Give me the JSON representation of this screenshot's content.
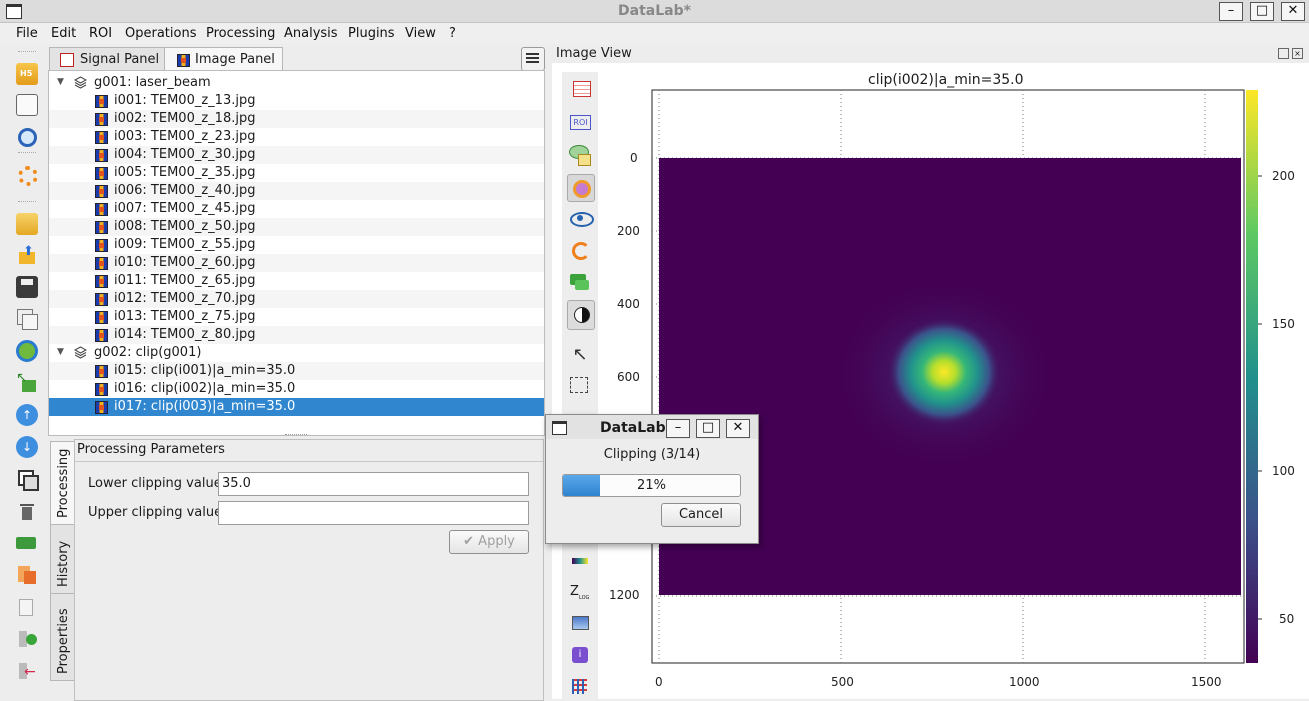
{
  "window": {
    "title": "DataLab*"
  },
  "menu": [
    "File",
    "Edit",
    "ROI",
    "Operations",
    "Processing",
    "Analysis",
    "Plugins",
    "View",
    "?"
  ],
  "toolbar_icons": [
    "open-h5-icon",
    "save-h5-icon",
    "browse-h5-icon",
    "settings-icon",
    "open-folder-icon",
    "import-icon",
    "save-icon",
    "duplicate-icon",
    "refresh-icon",
    "export-icon",
    "move-up-icon",
    "move-down-icon",
    "copy-icon",
    "delete-icon",
    "add-group-icon",
    "paste-metadata-icon",
    "copy-metadata-icon",
    "add-result-icon",
    "remove-result-icon"
  ],
  "tabs": {
    "signal": "Signal Panel",
    "image": "Image Panel"
  },
  "tree": {
    "groups": [
      {
        "label": "g001: laser_beam",
        "items": [
          "i001: TEM00_z_13.jpg",
          "i002: TEM00_z_18.jpg",
          "i003: TEM00_z_23.jpg",
          "i004: TEM00_z_30.jpg",
          "i005: TEM00_z_35.jpg",
          "i006: TEM00_z_40.jpg",
          "i007: TEM00_z_45.jpg",
          "i008: TEM00_z_50.jpg",
          "i009: TEM00_z_55.jpg",
          "i010: TEM00_z_60.jpg",
          "i011: TEM00_z_65.jpg",
          "i012: TEM00_z_70.jpg",
          "i013: TEM00_z_75.jpg",
          "i014: TEM00_z_80.jpg"
        ]
      },
      {
        "label": "g002: clip(g001)",
        "items": [
          "i015: clip(i001)|a_min=35.0",
          "i016: clip(i002)|a_min=35.0",
          "i017: clip(i003)|a_min=35.0"
        ]
      }
    ],
    "selected": "i017: clip(i003)|a_min=35.0"
  },
  "side_tabs": [
    "Processing",
    "History",
    "Properties"
  ],
  "params": {
    "title": "Processing Parameters",
    "lower_label": "Lower clipping value",
    "lower_value": "35.0",
    "upper_label": "Upper clipping value",
    "upper_value": "",
    "apply": "Apply"
  },
  "view": {
    "header": "Image View",
    "plot_title": "clip(i002)|a_min=35.0",
    "x_ticks": [
      "0",
      "500",
      "1000",
      "1500"
    ],
    "y_ticks": [
      "0",
      "200",
      "400",
      "600",
      "1200"
    ],
    "colorbar_ticks": [
      "200",
      "150",
      "100",
      "50"
    ],
    "roi_label": "ROI",
    "z_label": "Z",
    "z_sub": "LOG"
  },
  "dialog": {
    "title": "DataLab",
    "message": "Clipping (3/14)",
    "progress": 0.21,
    "progress_label": "21%",
    "cancel": "Cancel"
  },
  "colors": {
    "selection": "#3087cf",
    "progress": "#3a8fd6",
    "viridis_low": "#440154",
    "viridis_high": "#fde725"
  }
}
